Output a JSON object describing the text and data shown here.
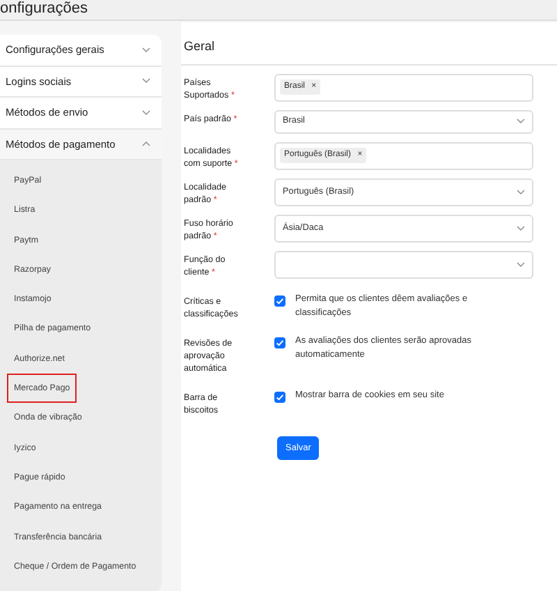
{
  "page_title": "onfigurações",
  "sidebar": {
    "sections": [
      {
        "label": "Configurações gerais",
        "expanded": false
      },
      {
        "label": "Logins sociais",
        "expanded": false
      },
      {
        "label": "Métodos de envio",
        "expanded": false
      },
      {
        "label": "Métodos de pagamento",
        "expanded": true,
        "items": [
          {
            "label": "PayPal",
            "selected": false
          },
          {
            "label": "Listra",
            "selected": false
          },
          {
            "label": "Paytm",
            "selected": false
          },
          {
            "label": "Razorpay",
            "selected": false
          },
          {
            "label": "Instamojo",
            "selected": false
          },
          {
            "label": "Pilha de pagamento",
            "selected": false
          },
          {
            "label": "Authorize.net",
            "selected": false
          },
          {
            "label": "Mercado Pago",
            "selected": true
          },
          {
            "label": "Onda de vibração",
            "selected": false
          },
          {
            "label": "Iyzico",
            "selected": false
          },
          {
            "label": "Pague rápido",
            "selected": false
          },
          {
            "label": "Pagamento na entrega",
            "selected": false
          },
          {
            "label": "Transferência bancária",
            "selected": false
          },
          {
            "label": "Cheque / Ordem de Pagamento",
            "selected": false
          }
        ]
      }
    ]
  },
  "panel": {
    "title": "Geral",
    "fields": [
      {
        "kind": "tags",
        "label": "Países Suportados",
        "required_mark": "*",
        "tags": [
          "Brasil"
        ],
        "remove": "×"
      },
      {
        "kind": "select",
        "label": "País padrão",
        "required_mark": "*",
        "value": "Brasil"
      },
      {
        "kind": "tags",
        "label": "Localidades com suporte",
        "required_mark": "*",
        "tags": [
          "Português (Brasil)"
        ],
        "remove": "×"
      },
      {
        "kind": "select",
        "label": "Localidade padrão",
        "required_mark": "*",
        "value": "Português (Brasil)"
      },
      {
        "kind": "select",
        "label": "Fuso horário padrão",
        "required_mark": "*",
        "value": "Ásia/Daca"
      },
      {
        "kind": "select",
        "label": "Função do cliente",
        "required_mark": "*"
      },
      {
        "kind": "checkbox",
        "label": "Críticas e classificações",
        "checked": true,
        "text": "Permita que os clientes dêem avaliações e classificações"
      },
      {
        "kind": "checkbox",
        "label": "Revisões de aprovação automática",
        "checked": true,
        "text": "As avaliações dos clientes serão aprovadas automaticamente"
      },
      {
        "kind": "checkbox",
        "label": "Barra de biscoitos",
        "checked": true,
        "text": "Mostrar barra de cookies em seu site"
      }
    ],
    "save_button": "Salvar"
  }
}
